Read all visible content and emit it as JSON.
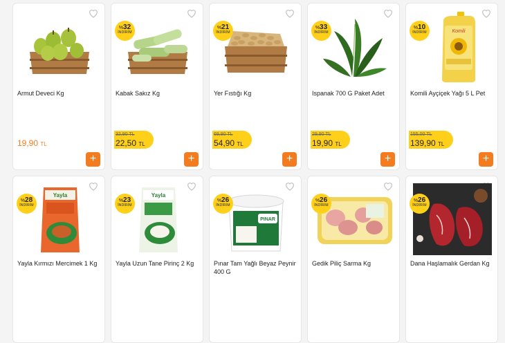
{
  "products": [
    {
      "name": "Armut Deveci Kg",
      "discount": "",
      "old_price": "",
      "price": "19,90",
      "currency": "TL",
      "image": "pears-in-crate"
    },
    {
      "name": "Kabak Sakız Kg",
      "discount": "32",
      "old_price": "32,90 TL",
      "price": "22,50",
      "currency": "TL",
      "image": "zucchini-in-crate"
    },
    {
      "name": "Yer Fıstığı Kg",
      "discount": "21",
      "old_price": "69,90 TL",
      "price": "54,90",
      "currency": "TL",
      "image": "peanuts-in-crate"
    },
    {
      "name": "Ispanak 700 G Paket Adet",
      "discount": "33",
      "old_price": "29,90 TL",
      "price": "19,90",
      "currency": "TL",
      "image": "spinach"
    },
    {
      "name": "Komili Ayçiçek Yağı 5 L Pet",
      "discount": "10",
      "old_price": "155,00 TL",
      "price": "139,90",
      "currency": "TL",
      "image": "oil-bottle"
    },
    {
      "name": "Yayla Kırmızı Mercimek 1 Kg",
      "discount": "28",
      "image": "lentil-pack"
    },
    {
      "name": "Yayla Uzun Tane Pirinç 2 Kg",
      "discount": "23",
      "image": "rice-pack"
    },
    {
      "name": "Pınar Tam Yağlı Beyaz Peynir 400 G",
      "discount": "26",
      "image": "cheese-tub"
    },
    {
      "name": "Gedik Piliç Sarma Kg",
      "discount": "26",
      "image": "chicken-tray"
    },
    {
      "name": "Dana Haşlamalık Gerdan Kg",
      "discount": "26",
      "image": "beef-pieces"
    }
  ],
  "discount_label": "İNDİRİM",
  "pct_symbol": "%",
  "add_symbol": "+",
  "accent": "#f47c20",
  "badge_color": "#ffd01a"
}
